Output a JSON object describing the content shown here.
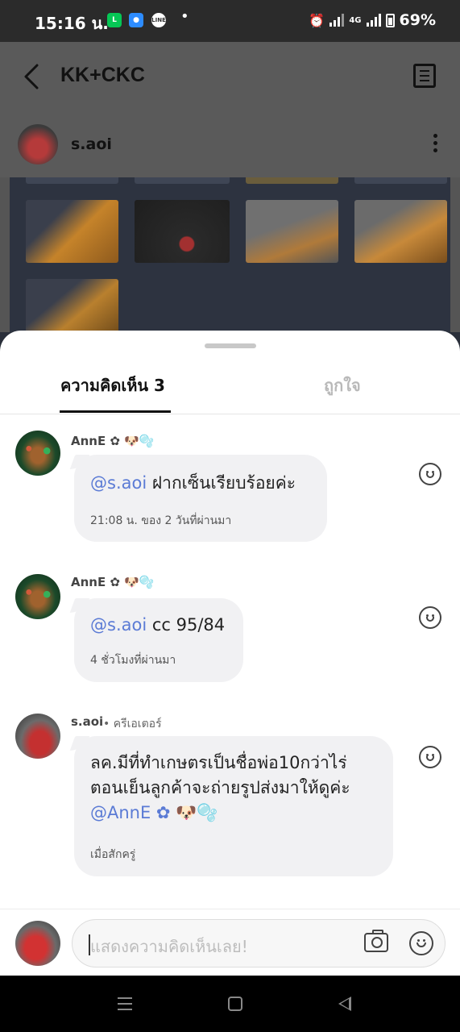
{
  "status_bar": {
    "time": "15:16 น.",
    "network": "4G",
    "battery": "69%",
    "apps": [
      {
        "icon": "line-app-icon",
        "color": "#06c755"
      },
      {
        "icon": "blue-app-icon",
        "color": "#2d8cff"
      },
      {
        "icon": "line-chat-icon",
        "color": "#ffffff"
      }
    ]
  },
  "header": {
    "title": "KK+CKC"
  },
  "post": {
    "author": "s.aoi"
  },
  "sheet": {
    "tabs": [
      {
        "label": "ความคิดเห็น 3",
        "active": true
      },
      {
        "label": "ถูกใจ",
        "active": false
      }
    ]
  },
  "comments": [
    {
      "author": "AnnE ✿ 🐶🫧",
      "mention": "@s.aoi",
      "text": " ฝากเซ็นเรียบร้อยค่ะ",
      "time": "21:08 น. ของ 2 วันที่ผ่านมา"
    },
    {
      "author": "AnnE ✿ 🐶🫧",
      "mention": "@s.aoi",
      "text": " cc 95/84",
      "time": "4 ชั่วโมงที่ผ่านมา"
    },
    {
      "author": "s.aoi",
      "badge": "• ครีเอเตอร์",
      "line1": "ลค.มีที่ทำเกษตรเป็นชื่อพ่อ10กว่าไร่",
      "line2": "ตอนเย็นลูกค้าจะถ่ายรูปส่งมาให้ดูค่ะ",
      "mention": "@AnnE ✿",
      "emoji": " 🐶🫧",
      "time": "เมื่อสักครู่"
    }
  ],
  "composer": {
    "placeholder": "แสดงความคิดเห็นเลย!"
  },
  "colors": {
    "mention": "#5b7bd5",
    "bubble": "#f1f1f3",
    "dim_overlay": "#555555"
  }
}
